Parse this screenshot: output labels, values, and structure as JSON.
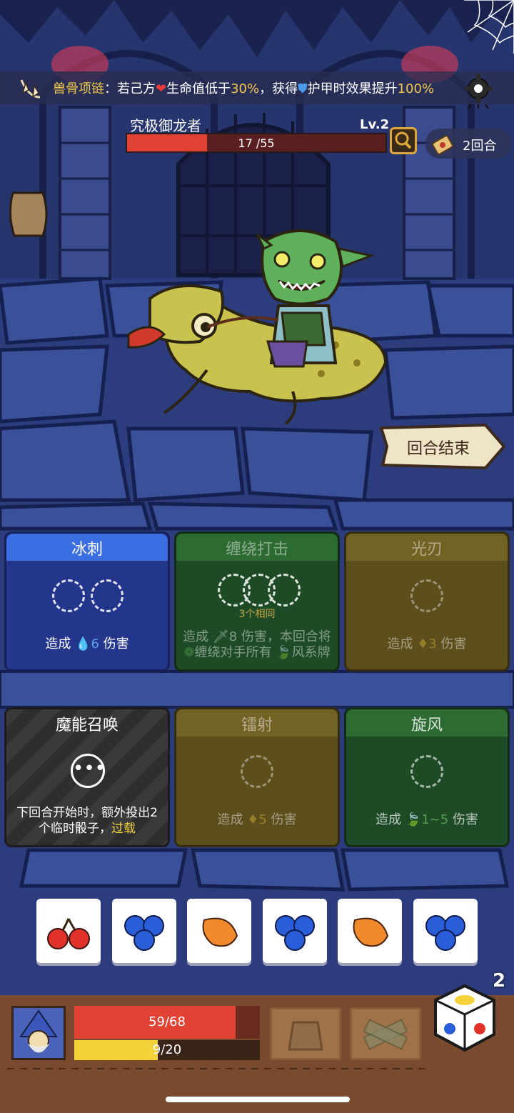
{
  "relic": {
    "name": "兽骨项链",
    "colon": "：",
    "desc_pre": "若己方",
    "heart": "❤",
    "desc_mid": "生命值低于",
    "threshold": "30%",
    "desc_mid2": "，获得",
    "shield": "⛊",
    "desc_post": "护甲时效果提升",
    "boost": "100%"
  },
  "enemy": {
    "name": "究极御龙者",
    "level": "Lv.2",
    "hp_text": "17 /55",
    "hp_fraction": 0.31
  },
  "turn": {
    "round_text": "2回合"
  },
  "end_turn_label": "回合结束",
  "cards": [
    {
      "title": "冰刺",
      "desc_pre": "造成 ",
      "icon": "💧",
      "amount": "6",
      "desc_post": " 伤害"
    },
    {
      "title": "缠绕打击",
      "note": "3个相同",
      "line1_pre": "造成 ",
      "line1_icon": "🗡",
      "line1_amt": "8",
      "line1_post": " 伤害，本回合将",
      "line2_pre": "缠绕对手所有 ",
      "line2_post": "风系牌"
    },
    {
      "title": "光刃",
      "desc_pre": "造成 ",
      "icon": "♦",
      "amount": "3",
      "desc_post": " 伤害"
    },
    {
      "title": "魔能召唤",
      "line1": "下回合开始时，额外投出2",
      "line2_pre": "个临时骰子，",
      "line2_hl": "过载"
    },
    {
      "title": "镭射",
      "desc_pre": "造成 ",
      "icon": "♦",
      "amount": "5",
      "desc_post": " 伤害"
    },
    {
      "title": "旋风",
      "desc_pre": "造成 ",
      "icon": "🍃",
      "amount": "1~5",
      "desc_post": " 伤害"
    }
  ],
  "dice": [
    "cherry",
    "blueberry",
    "orange",
    "blueberry",
    "orange",
    "blueberry"
  ],
  "player": {
    "hp_text": "59/68",
    "hp_fraction": 0.868,
    "xp_text": "9/20",
    "xp_fraction": 0.45
  },
  "dice_remaining": "2",
  "colors": {
    "gold": "#f4c84a",
    "red": "#e24234",
    "blue_card": "#23368c",
    "green_card": "#1e4a26",
    "olive_card": "#5c4f1c"
  }
}
